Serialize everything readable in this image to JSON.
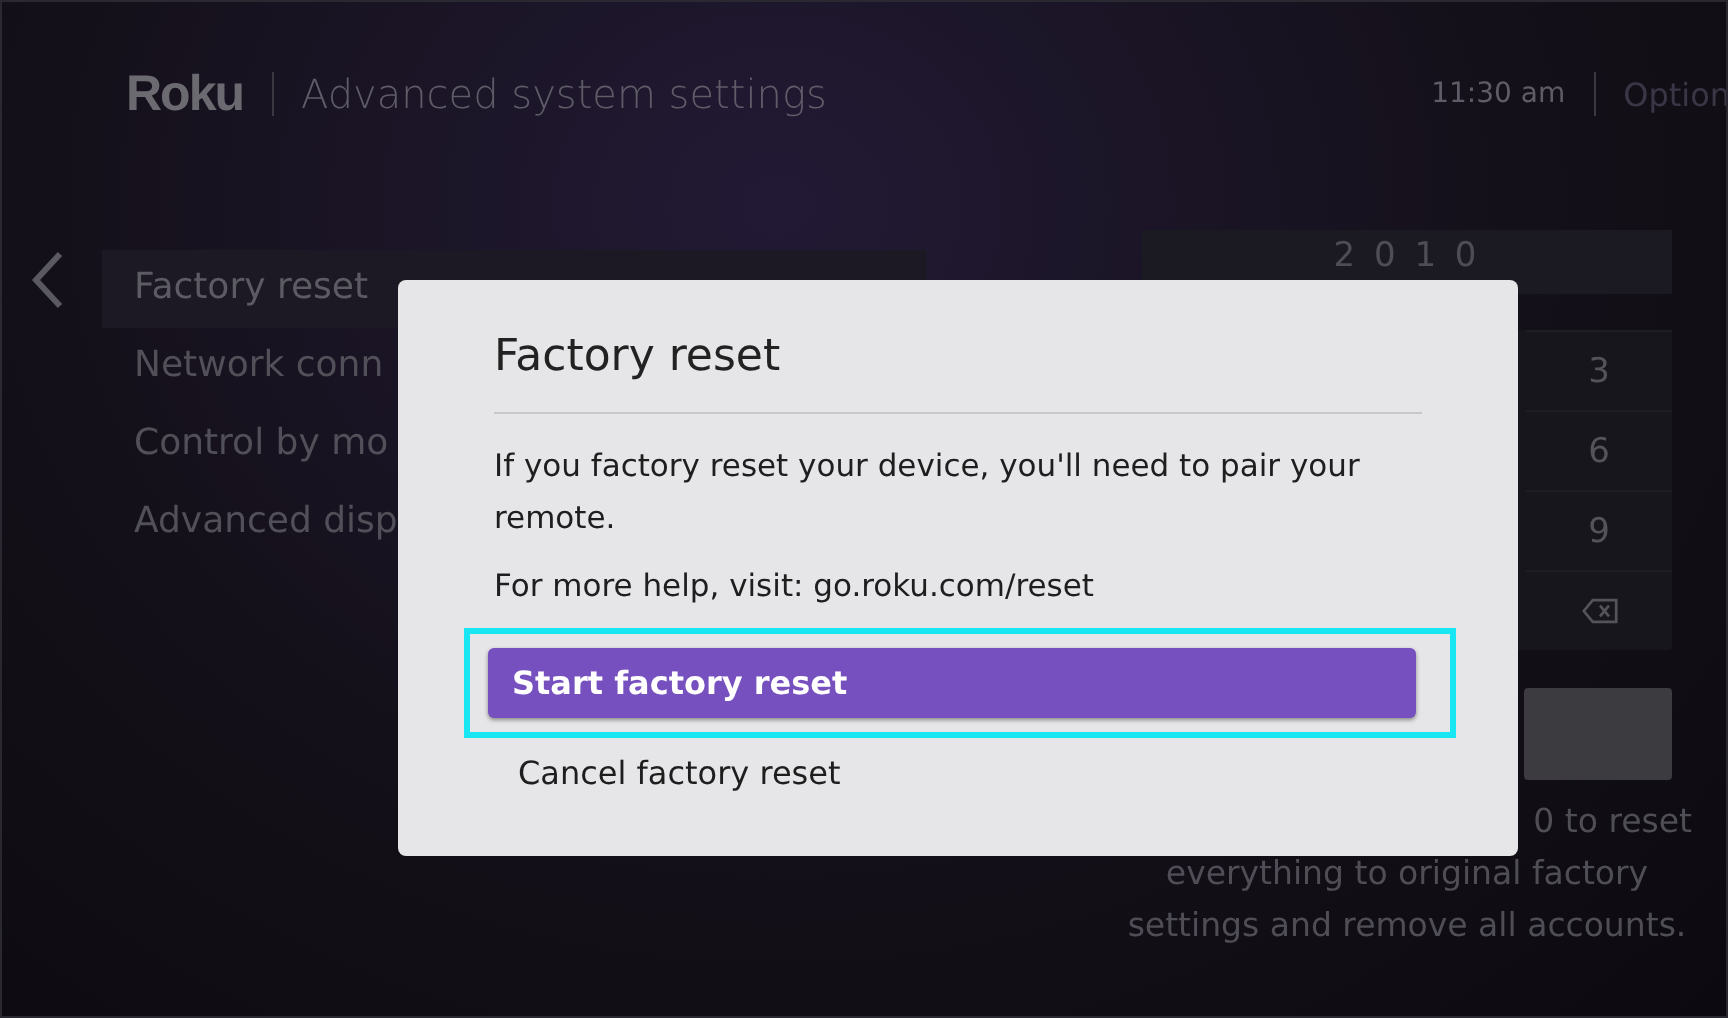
{
  "header": {
    "logo": "Roku",
    "title": "Advanced system settings",
    "time": "11:30 am",
    "options": "Option"
  },
  "menu": {
    "items": [
      {
        "label": "Factory reset",
        "selected": true
      },
      {
        "label": "Network conn",
        "selected": false
      },
      {
        "label": "Control by mo",
        "selected": false
      },
      {
        "label": "Advanced disp",
        "selected": false
      }
    ]
  },
  "code_field": {
    "value": "2 0 1 0"
  },
  "keypad": {
    "keys": [
      {
        "kind": "digit",
        "label": "3"
      },
      {
        "kind": "digit",
        "label": "6"
      },
      {
        "kind": "digit",
        "label": "9"
      },
      {
        "kind": "backspace"
      }
    ]
  },
  "panel_text": [
    "0 to reset",
    "everything to original factory",
    "settings and remove all accounts."
  ],
  "dialog": {
    "title": "Factory reset",
    "paragraphs": [
      "If you factory reset your device, you'll need to pair your remote.",
      "For more help, visit: go.roku.com/reset"
    ],
    "buttons": [
      {
        "label": "Start factory reset",
        "selected": true
      },
      {
        "label": "Cancel factory reset",
        "selected": false
      }
    ]
  }
}
